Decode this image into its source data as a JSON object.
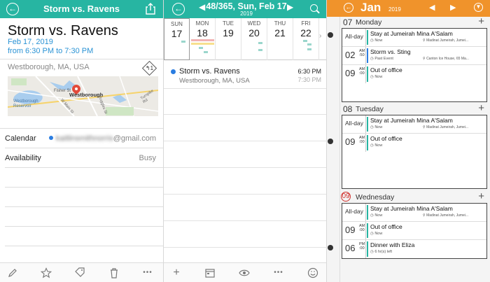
{
  "detail": {
    "header_title": "Storm vs. Ravens",
    "event_title": "Storm vs. Ravens",
    "date": "Feb 17, 2019",
    "time_range": "from 6:30 PM to 7:30 PM",
    "location": "Westborough, MA, USA",
    "map_label": "Westborough",
    "map_streets": [
      "Fisher St",
      "Westborough Reservoir",
      "W Main St",
      "Chauncy",
      "Ruggles St",
      "Turnpike Rd"
    ],
    "calendar_label": "Calendar",
    "calendar_value_hidden": "kaitlinsmithnorris",
    "calendar_value_domain": "@gmail.com",
    "availability_label": "Availability",
    "availability_value": "Busy",
    "directions_glyph": "↰1"
  },
  "week": {
    "title": "48/365, Sun, Feb 17",
    "year": "2019",
    "days": [
      {
        "name": "SUN",
        "date": "17",
        "selected": true
      },
      {
        "name": "MON",
        "date": "18"
      },
      {
        "name": "TUE",
        "date": "19"
      },
      {
        "name": "WED",
        "date": "20"
      },
      {
        "name": "THU",
        "date": "21"
      },
      {
        "name": "FRI",
        "date": "22"
      }
    ],
    "agenda": [
      {
        "title": "Storm vs. Ravens",
        "location": "Westborough, MA, USA",
        "start": "6:30 PM",
        "end": "7:30 PM",
        "color": "#2a7de1"
      }
    ]
  },
  "daylist": {
    "month": "Jan",
    "year": "2019",
    "sections": [
      {
        "num": "07",
        "weekday": "Monday",
        "today": false,
        "events": [
          {
            "time": "All-day",
            "title": "Stay at Jumeirah Mina A'Salam",
            "sub": "Now",
            "sub2": "Madinat Jumeirah, Jumei...",
            "color": "#27b5a2"
          },
          {
            "time": "02",
            "ampm": "AM :50",
            "title": "Storm vs. Sting",
            "sub": "Past Event",
            "sub2": "Canton Ice House, 65 Ma...",
            "color": "#2a7de1"
          },
          {
            "time": "09",
            "ampm": "AM :00",
            "title": "Out of office",
            "sub": "Now",
            "sub2": "",
            "color": "#27b5a2"
          }
        ]
      },
      {
        "num": "08",
        "weekday": "Tuesday",
        "today": false,
        "events": [
          {
            "time": "All-day",
            "title": "Stay at Jumeirah Mina A'Salam",
            "sub": "Now",
            "sub2": "Madinat Jumeirah, Jumei...",
            "color": "#27b5a2"
          },
          {
            "time": "09",
            "ampm": "AM :00",
            "title": "Out of office",
            "sub": "Now",
            "sub2": "",
            "color": "#27b5a2"
          }
        ]
      },
      {
        "num": "09",
        "weekday": "Wednesday",
        "today": true,
        "events": [
          {
            "time": "All-day",
            "title": "Stay at Jumeirah Mina A'Salam",
            "sub": "Now",
            "sub2": "Madinat Jumeirah, Jumei...",
            "color": "#27b5a2"
          },
          {
            "time": "09",
            "ampm": "AM :00",
            "title": "Out of office",
            "sub": "Now",
            "sub2": "",
            "color": "#27b5a2"
          },
          {
            "time": "06",
            "ampm": "PM :00",
            "title": "Dinner with Eliza",
            "sub": "6 hr(s) left",
            "sub2": "",
            "color": "#27b5a2"
          }
        ]
      }
    ]
  },
  "colors": {
    "teal": "#27b5a2",
    "orange": "#f0932b",
    "blue": "#2a7de1",
    "today_red": "#d0312d"
  },
  "icons": [
    "back-icon",
    "share-icon",
    "directions-icon",
    "pencil-icon",
    "star-icon",
    "tag-icon",
    "trash-icon",
    "more-icon",
    "search-icon",
    "plus-icon",
    "calendar-icon",
    "eye-icon",
    "smiley-icon",
    "dropdown-icon"
  ]
}
